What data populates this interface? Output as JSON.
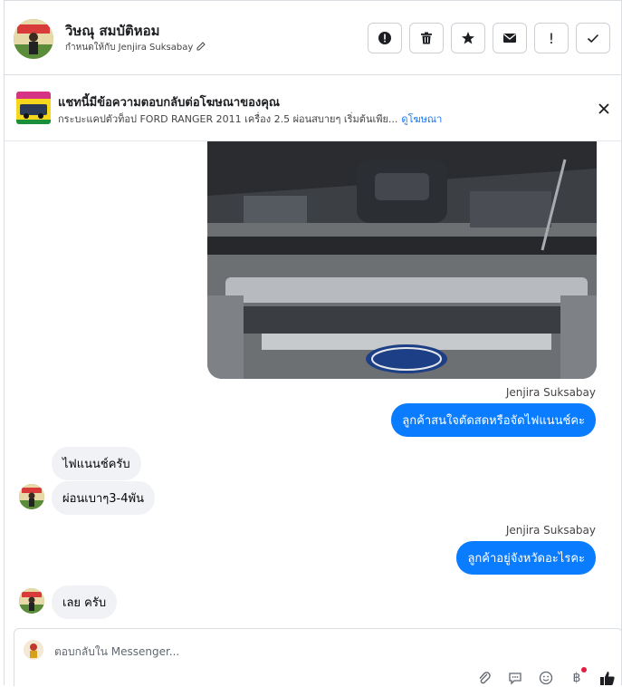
{
  "header": {
    "contact_name": "วิษณุ สมบัติหอม",
    "assigned_to": "กำหนดให้กับ Jenjira Suksabay",
    "actions": [
      {
        "icon": "alert-icon"
      },
      {
        "icon": "trash-icon"
      },
      {
        "icon": "star-icon"
      },
      {
        "icon": "mail-icon"
      },
      {
        "label": "!"
      },
      {
        "icon": "check-icon"
      }
    ]
  },
  "ad": {
    "title": "แชทนี้มีข้อความตอบกลับต่อโฆษณาของคุณ",
    "subtitle": "กระบะแคปตัวท็อป FORD RANGER 2011 เครื่อง 2.5 ผ่อนสบายๆ เริ่มต้นเพีย...",
    "link": "ดูโฆษณา"
  },
  "messages": {
    "sender_1": "Jenjira Suksabay",
    "out_1": "ลูกค้าสนใจตัดสดหรือจัดไฟแนนช์คะ",
    "in_1": "ไฟแนนช์ครับ",
    "in_2": "ผ่อนเบาๆ3-4พัน",
    "sender_2": "Jenjira Suksabay",
    "out_2": "ลูกค้าอยู่จังหวัดอะไรคะ",
    "in_3": "เลย ครับ"
  },
  "composer": {
    "placeholder": "ตอบกลับใน Messenger...",
    "currency_symbol": "฿"
  },
  "colors": {
    "accent": "#0a7cff",
    "incoming_bubble": "#f0f2f5",
    "notification_dot": "#e41e3f"
  }
}
